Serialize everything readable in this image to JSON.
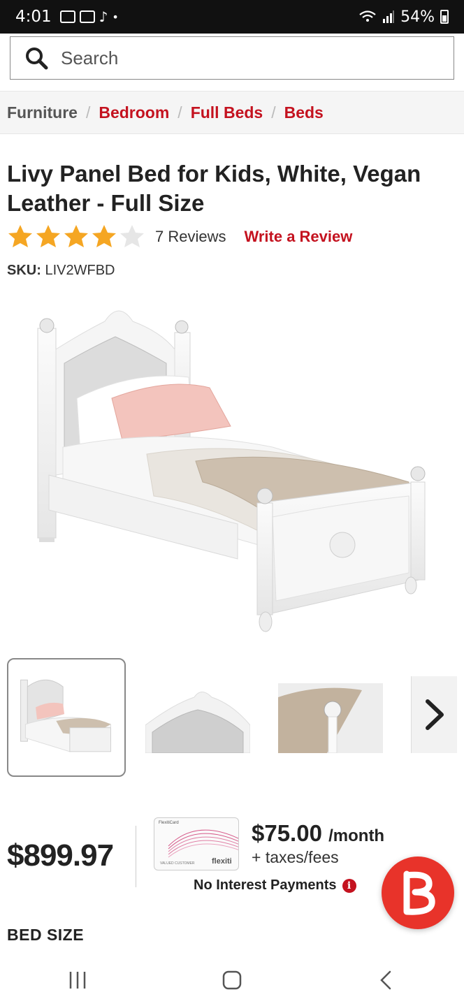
{
  "status_bar": {
    "time": "4:01",
    "battery": "54%"
  },
  "search": {
    "placeholder": "Search"
  },
  "breadcrumb": {
    "items": [
      "Furniture",
      "Bedroom",
      "Full Beds",
      "Beds"
    ]
  },
  "product": {
    "title": "Livy Panel Bed for Kids, White, Vegan Leather - Full Size",
    "rating": 4,
    "rating_max": 5,
    "reviews_label": "7 Reviews",
    "write_review_label": "Write a Review",
    "sku_label": "SKU:",
    "sku_value": "LIV2WFBD"
  },
  "pricing": {
    "price": "$899.97",
    "monthly_amount": "$75.00",
    "monthly_unit": "/month",
    "taxes_note": "+ taxes/fees",
    "no_interest_label": "No Interest Payments",
    "card_brand": "flexiti",
    "card_header": "FlexitiCard",
    "card_holder": "VALUED CUSTOMER"
  },
  "options": {
    "bed_size_label": "BED SIZE"
  },
  "colors": {
    "accent": "#c4121f",
    "star": "#f5a623",
    "chat": "#e8332a"
  }
}
